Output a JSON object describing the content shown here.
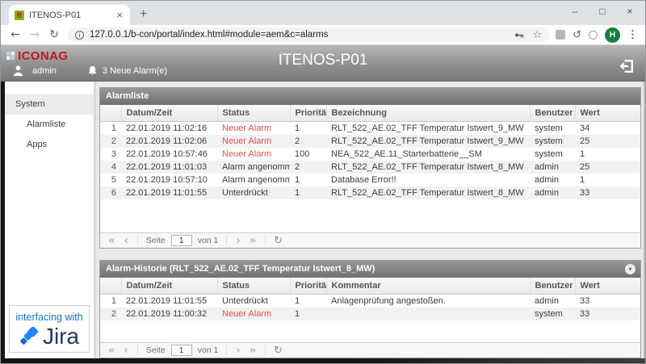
{
  "browser": {
    "tab_title": "ITENOS-P01",
    "favicon_letter": "B",
    "url": "127.0.0.1/b-con/portal/index.html#module=aem&c=alarms",
    "avatar_letter": "H"
  },
  "icons": {
    "back": "←",
    "forward": "→",
    "reload": "↻",
    "star": "☆",
    "history": "↺",
    "minimize": "–",
    "maximize": "□",
    "close": "×",
    "tab_close": "×",
    "new_tab": "+",
    "menu": "⋮",
    "info": "i",
    "first": "«",
    "prev": "‹",
    "next": "›",
    "last": "»",
    "refresh": "↻",
    "collapse": "▾"
  },
  "header": {
    "logo_text": "ICONAG",
    "title": "ITENOS-P01",
    "username": "admin",
    "alarms_badge": "3 Neue Alarm(e)"
  },
  "sidebar": {
    "items": [
      {
        "label": "System",
        "active": true
      },
      {
        "label": "Alarmliste",
        "active": false
      },
      {
        "label": "Apps",
        "active": false
      }
    ],
    "jira_tagline": "interfacing with",
    "jira_brand": "Jira"
  },
  "alarmlist": {
    "title": "Alarmliste",
    "columns": {
      "num": "",
      "datetime": "Datum/Zeit",
      "status": "Status",
      "priority": "Priorität",
      "text": "Bezeichnung",
      "user": "Benutzer",
      "value": "Wert"
    },
    "rows": [
      {
        "num": "1",
        "datetime": "22.01.2019 11:02:16",
        "status": "Neuer Alarm",
        "is_new": true,
        "priority": "1",
        "text": "RLT_522_AE.02_TFF Temperatur Istwert_9_MW",
        "user": "system",
        "value": "34"
      },
      {
        "num": "2",
        "datetime": "22.01.2019 11:02:06",
        "status": "Neuer Alarm",
        "is_new": true,
        "priority": "2",
        "text": "RLT_522_AE.02_TFF Temperatur Istwert_9_MW",
        "user": "system",
        "value": "25"
      },
      {
        "num": "3",
        "datetime": "22.01.2019 10:57:46",
        "status": "Neuer Alarm",
        "is_new": true,
        "priority": "100",
        "text": "NEA_522_AE.11_Starterbatterie__SM",
        "user": "system",
        "value": "1"
      },
      {
        "num": "4",
        "datetime": "22.01.2019 11:01:03",
        "status": "Alarm angenommen",
        "is_new": false,
        "priority": "2",
        "text": "RLT_522_AE.02_TFF Temperatur Istwert_8_MW",
        "user": "admin",
        "value": "25"
      },
      {
        "num": "5",
        "datetime": "22.01.2019 10:57:10",
        "status": "Alarm angenommen",
        "is_new": false,
        "priority": "1",
        "text": "Database Error!!",
        "user": "admin",
        "value": "1"
      },
      {
        "num": "6",
        "datetime": "22.01.2019 11:01:55",
        "status": "Unterdrückt",
        "is_new": false,
        "priority": "1",
        "text": "RLT_522_AE.02_TFF Temperatur Istwert_8_MW",
        "user": "admin",
        "value": "33"
      }
    ],
    "pagination": {
      "page_label": "Seite",
      "page_value": "1",
      "of_label": "von 1"
    }
  },
  "history": {
    "title": "Alarm-Historie (RLT_522_AE.02_TFF Temperatur Istwert_8_MW)",
    "columns": {
      "num": "",
      "datetime": "Datum/Zeit",
      "status": "Status",
      "priority": "Priorität",
      "text": "Kommentar",
      "user": "Benutzer",
      "value": "Wert"
    },
    "rows": [
      {
        "num": "1",
        "datetime": "22.01.2019 11:01:55",
        "status": "Unterdrückt",
        "is_new": false,
        "priority": "1",
        "text": "Anlagenprüfung angestoßen.",
        "user": "admin",
        "value": "33"
      },
      {
        "num": "2",
        "datetime": "22.01.2019 11:00:32",
        "status": "Neuer Alarm",
        "is_new": true,
        "priority": "1",
        "text": "",
        "user": "system",
        "value": "33"
      }
    ],
    "pagination": {
      "page_label": "Seite",
      "page_value": "1",
      "of_label": "von 1"
    }
  },
  "colors": {
    "alarm_red": "#dc4f4f",
    "logo_red": "#c41425",
    "avatar_green": "#1b7e3c",
    "jira_blue": "#2684FF"
  }
}
